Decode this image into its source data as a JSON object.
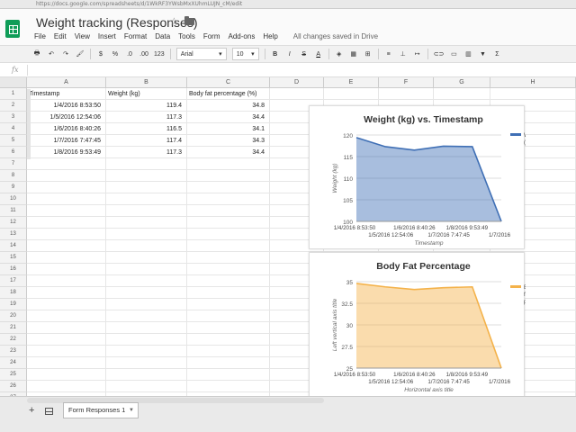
{
  "browser": {
    "url": "https://docs.google.com/spreadsheets/d/1WkRF3YWsbMxXUhmLUJN_cM/edit"
  },
  "doc": {
    "title": "Weight tracking (Responses)"
  },
  "menu": [
    "File",
    "Edit",
    "View",
    "Insert",
    "Format",
    "Data",
    "Tools",
    "Form",
    "Add-ons",
    "Help"
  ],
  "status": {
    "saved": "All changes saved in Drive"
  },
  "toolbar": {
    "currency": "$",
    "percent": "%",
    "dec_less": ".0",
    "dec_more": ".00",
    "format_more": "123",
    "font": "Arial",
    "size": "10",
    "bold": "B",
    "italic": "I",
    "strike": "S",
    "text_color": "A",
    "functions": "Σ"
  },
  "formula_bar": {
    "fx": "fx",
    "value": ""
  },
  "grid": {
    "columns": [
      "A",
      "B",
      "C",
      "D",
      "E",
      "F",
      "G",
      "H"
    ],
    "rows": [
      "1",
      "2",
      "3",
      "4",
      "5",
      "6",
      "7",
      "8",
      "9",
      "10",
      "11",
      "12",
      "13",
      "14",
      "15",
      "16",
      "17",
      "18",
      "19",
      "20",
      "21",
      "22",
      "23",
      "24",
      "25",
      "26",
      "27"
    ],
    "header": [
      "Timestamp",
      "Weight (kg)",
      "Body fat percentage (%)"
    ],
    "data": [
      [
        "1/4/2016 8:53:50",
        "119.4",
        "34.8"
      ],
      [
        "1/5/2016 12:54:06",
        "117.3",
        "34.4"
      ],
      [
        "1/6/2016 8:40:26",
        "116.5",
        "34.1"
      ],
      [
        "1/7/2016 7:47:45",
        "117.4",
        "34.3"
      ],
      [
        "1/8/2016 9:53:49",
        "117.3",
        "34.4"
      ]
    ]
  },
  "chart_data": [
    {
      "type": "area",
      "title": "Weight (kg) vs. Timestamp",
      "xlabel": "Timestamp",
      "ylabel": "Weight (kg)",
      "x": [
        "1/4/2016 8:53:50",
        "1/5/2016 12:54:06",
        "1/6/2016 8:40:26",
        "1/7/2016 7:47:45",
        "1/8/2016 9:53:49",
        "1/7/2016"
      ],
      "series": [
        {
          "name": "Weight (kg)",
          "values": [
            119.4,
            117.3,
            116.5,
            117.4,
            117.3,
            100
          ]
        }
      ],
      "ylim": [
        100,
        120
      ],
      "yticks": [
        "120",
        "115",
        "110",
        "105",
        "100"
      ],
      "legend": "right",
      "color": "#3f6fb5"
    },
    {
      "type": "area",
      "title": "Body Fat Percentage",
      "xlabel": "Horizontal axis title",
      "ylabel": "Left vertical axis title",
      "x": [
        "1/4/2016 8:53:50",
        "1/5/2016 12:54:06",
        "1/6/2016 8:40:26",
        "1/7/2016 7:47:45",
        "1/8/2016 9:53:49",
        "1/7/2016"
      ],
      "series": [
        {
          "name": "Body fat perc...",
          "values": [
            34.8,
            34.4,
            34.1,
            34.3,
            34.4,
            25
          ]
        }
      ],
      "ylim": [
        25,
        35
      ],
      "yticks": [
        "35",
        "32.5",
        "30",
        "27.5",
        "25"
      ],
      "legend": "right",
      "color": "#f4b24a"
    }
  ],
  "sheets": {
    "tab": "Form Responses 1"
  }
}
